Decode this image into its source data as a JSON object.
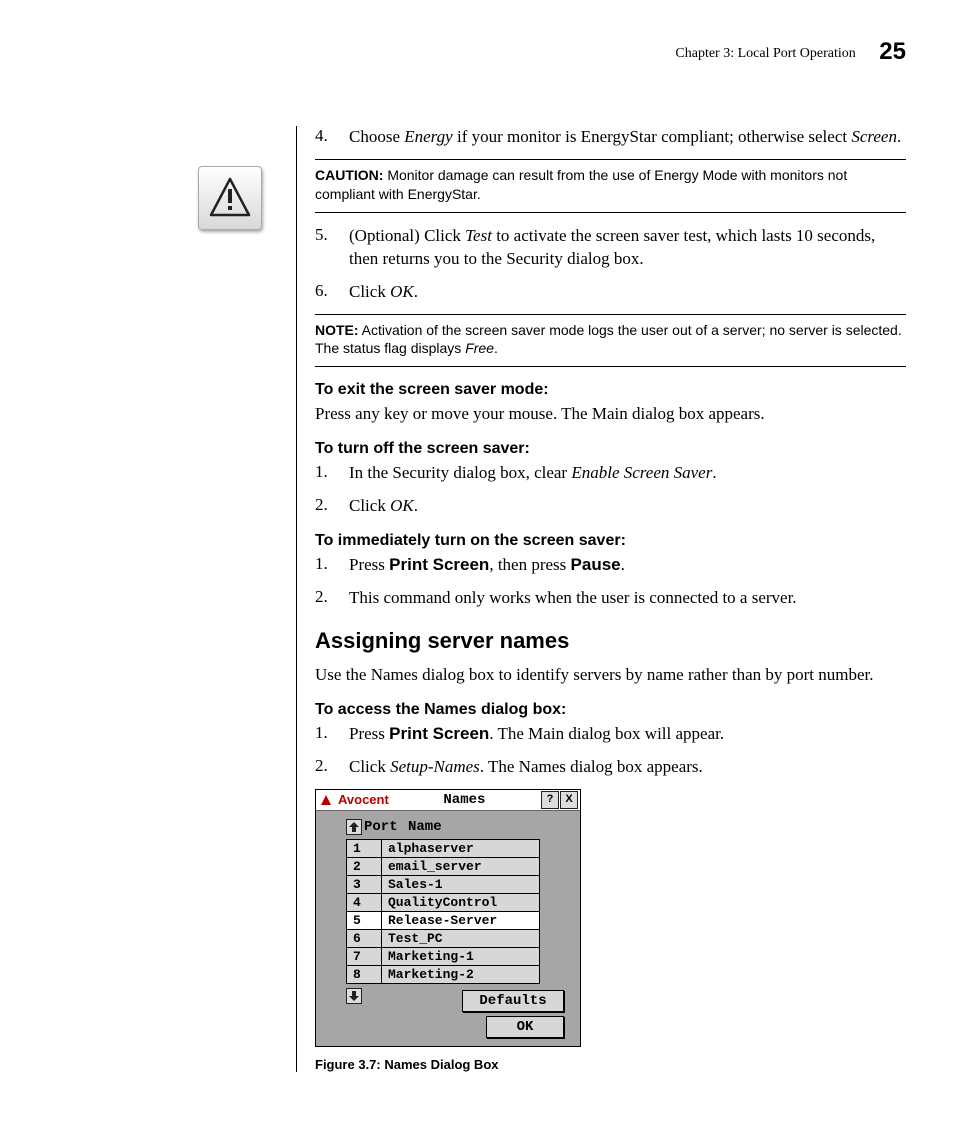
{
  "header": {
    "chapter": "Chapter 3: Local Port Operation",
    "page_number": "25"
  },
  "step4": {
    "num": "4.",
    "text_prefix": "Choose ",
    "em1": "Energy",
    "text_mid": " if your monitor is EnergyStar compliant; otherwise select ",
    "em2": "Screen",
    "text_suffix": "."
  },
  "caution": {
    "lead": "CAUTION:",
    "text": " Monitor damage can result from the use of Energy Mode with monitors not compliant with EnergyStar."
  },
  "step5": {
    "num": "5.",
    "text_prefix": "(Optional) Click ",
    "em1": "Test",
    "text_suffix": " to activate the screen saver test, which lasts 10 seconds, then returns you to the Security dialog box."
  },
  "step6": {
    "num": "6.",
    "text_prefix": "Click ",
    "em1": "OK",
    "text_suffix": "."
  },
  "note": {
    "lead": "NOTE:",
    "text_a": " Activation of the screen saver mode logs the user out of a server; no server is selected. The status flag displays ",
    "em": "Free",
    "text_b": "."
  },
  "sec_exit": {
    "heading": "To exit the screen saver mode:",
    "para": "Press any key or move your mouse. The Main dialog box appears."
  },
  "sec_turnoff": {
    "heading": "To turn off the screen saver:",
    "s1": {
      "num": "1.",
      "pre": "In the Security dialog box, clear ",
      "em": "Enable Screen Saver",
      "post": "."
    },
    "s2": {
      "num": "2.",
      "pre": "Click ",
      "em": "OK",
      "post": "."
    }
  },
  "sec_turnon": {
    "heading": "To immediately turn on the screen saver:",
    "s1": {
      "num": "1.",
      "a": "Press ",
      "b1": "Print Screen",
      "b": ", then press ",
      "b2": "Pause",
      "c": "."
    },
    "s2": {
      "num": "2.",
      "text": "This command only works when the user is connected to a server."
    }
  },
  "sec_assign": {
    "heading": "Assigning server names",
    "para": "Use the Names dialog box to identify servers by name rather than by port number."
  },
  "sec_access": {
    "heading": "To access the Names dialog box:",
    "s1": {
      "num": "1.",
      "a": "Press ",
      "b1": "Print Screen",
      "b": ". The Main dialog box will appear."
    },
    "s2": {
      "num": "2.",
      "a": "Click ",
      "em": "Setup-Names",
      "b": ". The Names dialog box appears."
    }
  },
  "dialog": {
    "brand": "Avocent",
    "title": "Names",
    "help_glyph": "?",
    "close_glyph": "X",
    "col_port": "Port",
    "col_name": "Name",
    "rows": [
      {
        "port": "1",
        "name": "alphaserver"
      },
      {
        "port": "2",
        "name": "email_server"
      },
      {
        "port": "3",
        "name": "Sales-1"
      },
      {
        "port": "4",
        "name": "QualityControl"
      },
      {
        "port": "5",
        "name": "Release-Server"
      },
      {
        "port": "6",
        "name": "Test_PC"
      },
      {
        "port": "7",
        "name": "Marketing-1"
      },
      {
        "port": "8",
        "name": "Marketing-2"
      }
    ],
    "selected_index": 4,
    "btn_defaults": "Defaults",
    "btn_ok": "OK"
  },
  "figure_caption": "Figure 3.7: Names Dialog Box"
}
